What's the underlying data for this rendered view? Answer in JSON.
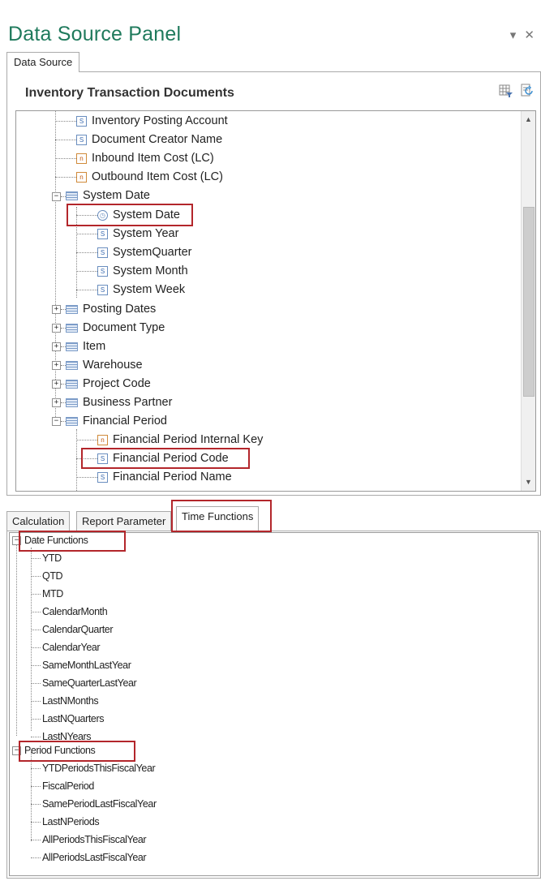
{
  "window": {
    "title": "Data Source Panel",
    "pin_icon": "pin-dropdown-icon",
    "close_icon": "close-icon"
  },
  "top_tabs": [
    {
      "label": "Data Source"
    }
  ],
  "data_source": {
    "header": "Inventory Transaction Documents",
    "header_icons": [
      "filter-icon",
      "refresh-icon"
    ],
    "tree": [
      {
        "label": "Inventory Posting Account",
        "icon": "S"
      },
      {
        "label": "Document Creator Name",
        "icon": "S"
      },
      {
        "label": "Inbound Item Cost (LC)",
        "icon": "n"
      },
      {
        "label": "Outbound Item Cost (LC)",
        "icon": "n"
      },
      {
        "label": "System Date",
        "icon": "group",
        "expanded": true
      },
      {
        "label": "System Date",
        "icon": "clock",
        "highlighted": true
      },
      {
        "label": "System Year",
        "icon": "S"
      },
      {
        "label": "SystemQuarter",
        "icon": "S"
      },
      {
        "label": "System Month",
        "icon": "S"
      },
      {
        "label": "System Week",
        "icon": "S"
      },
      {
        "label": "Posting Dates",
        "icon": "group",
        "expanded": false
      },
      {
        "label": "Document Type",
        "icon": "group",
        "expanded": false
      },
      {
        "label": "Item",
        "icon": "group",
        "expanded": false
      },
      {
        "label": "Warehouse",
        "icon": "group",
        "expanded": false
      },
      {
        "label": "Project Code",
        "icon": "group",
        "expanded": false
      },
      {
        "label": "Business Partner",
        "icon": "group",
        "expanded": false
      },
      {
        "label": "Financial Period",
        "icon": "group",
        "expanded": true
      },
      {
        "label": "Financial Period Internal Key",
        "icon": "n"
      },
      {
        "label": "Financial Period Code",
        "icon": "S",
        "highlighted": true
      },
      {
        "label": "Financial Period Name",
        "icon": "S"
      }
    ]
  },
  "bottom_tabs": [
    {
      "label": "Calculation"
    },
    {
      "label": "Report Parameter"
    },
    {
      "label": "Time Functions",
      "active": true
    }
  ],
  "time_functions": {
    "groups": [
      {
        "label": "Date Functions",
        "items": [
          "YTD",
          "QTD",
          "MTD",
          "CalendarMonth",
          "CalendarQuarter",
          "CalendarYear",
          "SameMonthLastYear",
          "SameQuarterLastYear",
          "LastNMonths",
          "LastNQuarters",
          "LastNYears"
        ]
      },
      {
        "label": "Period Functions",
        "items": [
          "YTDPeriodsThisFiscalYear",
          "FiscalPeriod",
          "SamePeriodLastFiscalYear",
          "LastNPeriods",
          "AllPeriodsThisFiscalYear",
          "AllPeriodsLastFiscalYear"
        ]
      }
    ]
  },
  "colors": {
    "title": "#1f7a5c",
    "highlight": "#b3262b"
  }
}
